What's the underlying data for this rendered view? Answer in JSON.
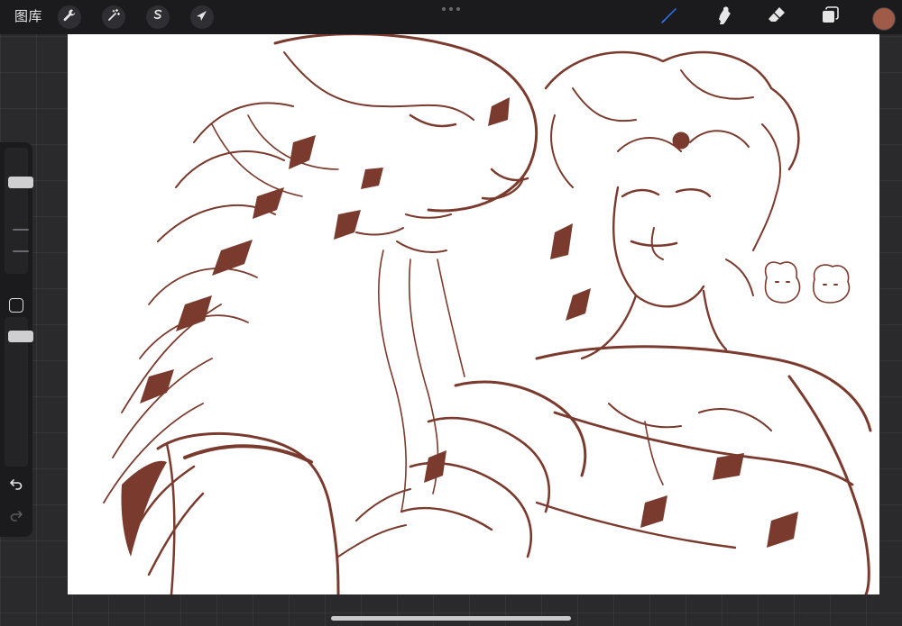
{
  "toolbar": {
    "gallery_label": "图库",
    "left_tools": [
      {
        "name": "actions",
        "icon": "wrench-icon"
      },
      {
        "name": "adjustments",
        "icon": "magic-wand-icon"
      },
      {
        "name": "selection",
        "icon": "selection-s-icon"
      },
      {
        "name": "transform",
        "icon": "arrow-cursor-icon"
      }
    ],
    "right_tools": [
      {
        "name": "brush",
        "icon": "brush-icon",
        "active": true
      },
      {
        "name": "smudge",
        "icon": "smudge-finger-icon",
        "active": false
      },
      {
        "name": "eraser",
        "icon": "eraser-icon",
        "active": false
      },
      {
        "name": "layers",
        "icon": "layers-icon",
        "active": false
      }
    ],
    "current_color": "#a05a48"
  },
  "sidebar": {
    "brush_size_level": 0.75,
    "brush_opacity_level": 0.9,
    "undo_icon": "undo-arrow-icon",
    "redo_icon": "redo-arrow-icon",
    "redo_enabled": false
  },
  "canvas": {
    "background": "#ffffff",
    "ink_color": "#7a3b2e",
    "content": "line-art sketch"
  },
  "colors": {
    "accent_blue": "#2f7bff",
    "chrome": "#1b1b1d"
  }
}
